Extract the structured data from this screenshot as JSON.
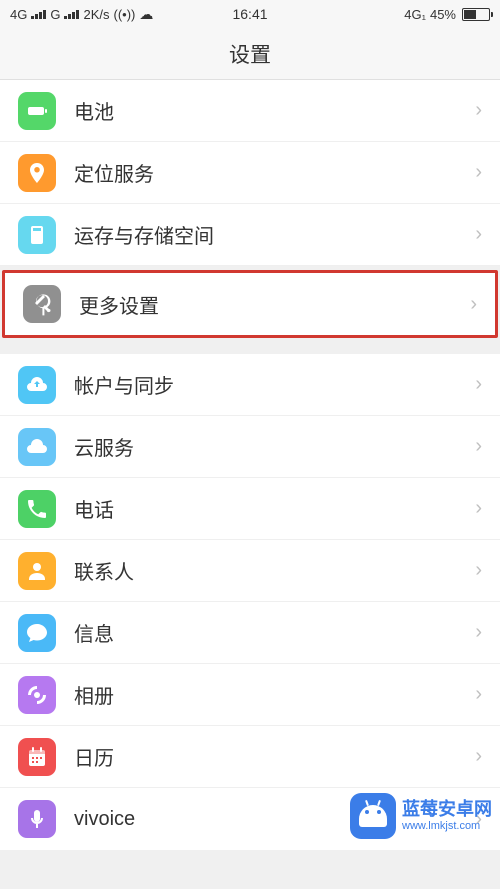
{
  "status": {
    "net1": "4G",
    "net2": "G",
    "speed": "2K/s",
    "time": "16:41",
    "net_right": "4G₁",
    "battery": "45%"
  },
  "header": {
    "title": "设置"
  },
  "sections": [
    {
      "items": [
        {
          "id": "battery",
          "label": "电池",
          "icon": "battery",
          "highlighted": false
        },
        {
          "id": "location",
          "label": "定位服务",
          "icon": "location",
          "highlighted": false
        },
        {
          "id": "storage",
          "label": "运存与存储空间",
          "icon": "storage",
          "highlighted": false
        },
        {
          "id": "more",
          "label": "更多设置",
          "icon": "more",
          "highlighted": true
        }
      ]
    },
    {
      "items": [
        {
          "id": "account",
          "label": "帐户与同步",
          "icon": "account",
          "highlighted": false
        },
        {
          "id": "cloud",
          "label": "云服务",
          "icon": "cloud",
          "highlighted": false
        },
        {
          "id": "phone",
          "label": "电话",
          "icon": "phone",
          "highlighted": false
        },
        {
          "id": "contacts",
          "label": "联系人",
          "icon": "contacts",
          "highlighted": false
        },
        {
          "id": "messages",
          "label": "信息",
          "icon": "messages",
          "highlighted": false
        },
        {
          "id": "gallery",
          "label": "相册",
          "icon": "gallery",
          "highlighted": false
        },
        {
          "id": "calendar",
          "label": "日历",
          "icon": "calendar",
          "highlighted": false
        },
        {
          "id": "vivoice",
          "label": "vivoice",
          "icon": "vivoice",
          "highlighted": false
        }
      ]
    }
  ],
  "watermark": {
    "line1": "蓝莓安卓网",
    "line2": "www.lmkjst.com"
  }
}
